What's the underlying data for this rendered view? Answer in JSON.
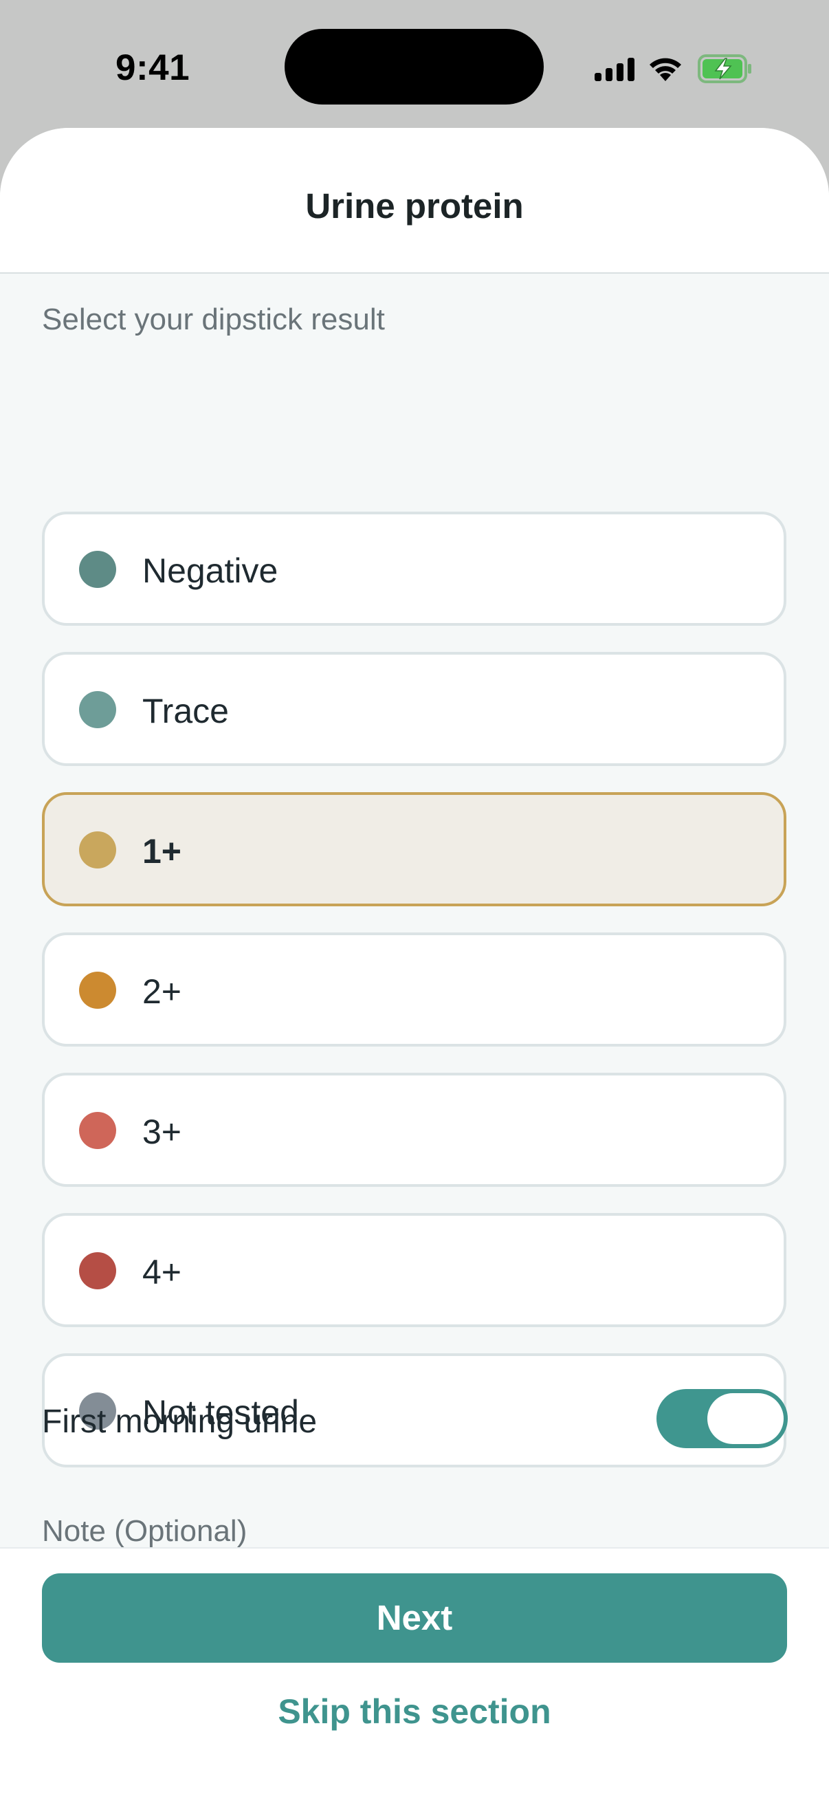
{
  "status_bar": {
    "time": "9:41",
    "icons": [
      "cellular-signal-icon",
      "wifi-icon",
      "battery-charging-icon"
    ]
  },
  "header": {
    "title": "Urine protein"
  },
  "main": {
    "section_label": "Select your dipstick result",
    "options": [
      {
        "label": "Negative",
        "color": "#5e8b86",
        "selected": false
      },
      {
        "label": "Trace",
        "color": "#6e9d98",
        "selected": false
      },
      {
        "label": "1+",
        "color": "#c9a75d",
        "selected": true
      },
      {
        "label": "2+",
        "color": "#cc8a30",
        "selected": false
      },
      {
        "label": "3+",
        "color": "#cf6659",
        "selected": false
      },
      {
        "label": "4+",
        "color": "#b54e45",
        "selected": false
      },
      {
        "label": "Not tested",
        "color": "#838d96",
        "selected": false
      }
    ],
    "first_morning": {
      "label": "First morning urine",
      "enabled": true
    },
    "note_label": "Note (Optional)"
  },
  "footer": {
    "next_label": "Next",
    "skip_label": "Skip this section"
  },
  "colors": {
    "accent": "#3f948e",
    "selected_border": "#c8a357",
    "selected_background": "#f0ede6"
  }
}
